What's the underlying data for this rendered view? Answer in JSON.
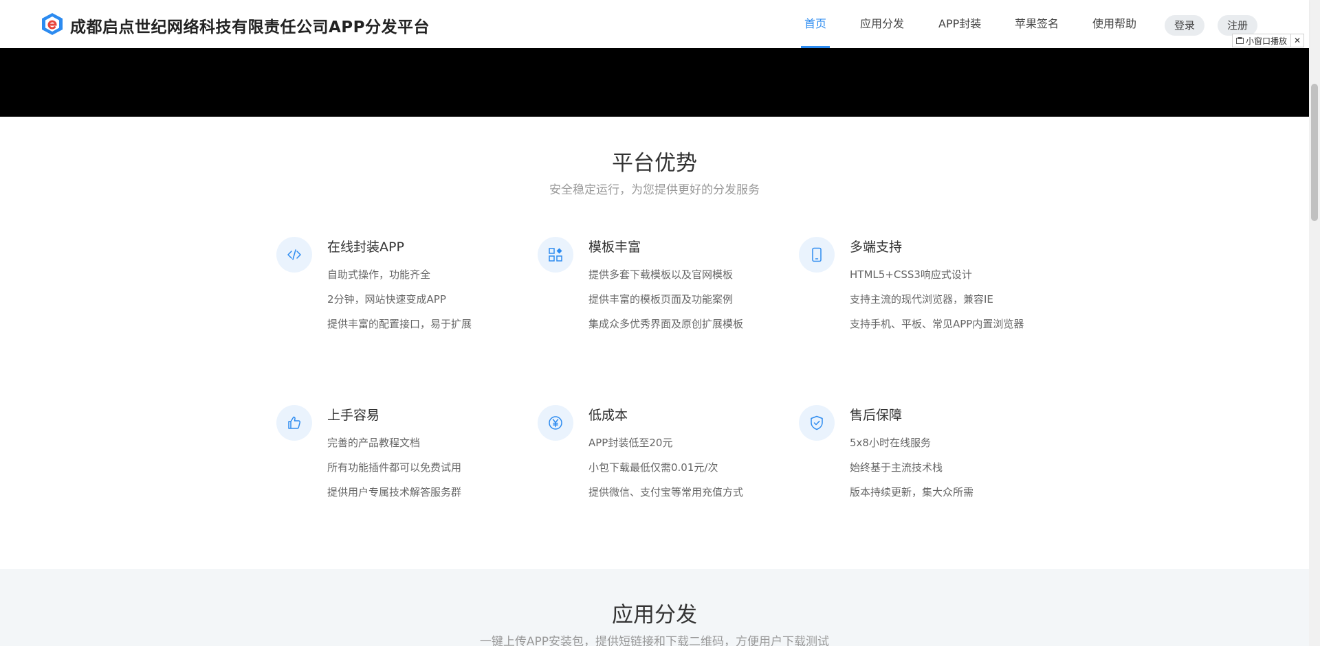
{
  "header": {
    "brand": "成都启点世纪网络科技有限责任公司APP分发平台",
    "nav": [
      {
        "label": "首页",
        "active": true
      },
      {
        "label": "应用分发",
        "active": false
      },
      {
        "label": "APP封装",
        "active": false
      },
      {
        "label": "苹果签名",
        "active": false
      },
      {
        "label": "使用帮助",
        "active": false
      }
    ],
    "login_label": "登录",
    "register_label": "注册",
    "accent_color": "#2c8bf0"
  },
  "mini_player": {
    "label": "小窗口播放",
    "close": "✕"
  },
  "advantages": {
    "title": "平台优势",
    "subtitle": "安全稳定运行，为您提供更好的分发服务",
    "features": [
      {
        "icon": "code-icon",
        "title": "在线封装APP",
        "lines": [
          "自助式操作，功能齐全",
          "2分钟，网站快速变成APP",
          "提供丰富的配置接口，易于扩展"
        ]
      },
      {
        "icon": "template-grid-icon",
        "title": "模板丰富",
        "lines": [
          "提供多套下载模板以及官网模板",
          "提供丰富的模板页面及功能案例",
          "集成众多优秀界面及原创扩展模板"
        ]
      },
      {
        "icon": "mobile-icon",
        "title": "多端支持",
        "lines": [
          "HTML5+CSS3响应式设计",
          "支持主流的现代浏览器，兼容IE",
          "支持手机、平板、常见APP内置浏览器"
        ]
      },
      {
        "icon": "thumbs-up-icon",
        "title": "上手容易",
        "lines": [
          "完善的产品教程文档",
          "所有功能插件都可以免费试用",
          "提供用户专属技术解答服务群"
        ]
      },
      {
        "icon": "yen-icon",
        "title": "低成本",
        "lines": [
          "APP封装低至20元",
          "小包下载最低仅需0.01元/次",
          "提供微信、支付宝等常用充值方式"
        ]
      },
      {
        "icon": "shield-check-icon",
        "title": "售后保障",
        "lines": [
          "5x8小时在线服务",
          "始终基于主流技术栈",
          "版本持续更新，集大众所需"
        ]
      }
    ]
  },
  "distribution": {
    "title": "应用分发",
    "subtitle": "一键上传APP安装包，提供短链接和下载二维码，方便用户下载测试"
  }
}
